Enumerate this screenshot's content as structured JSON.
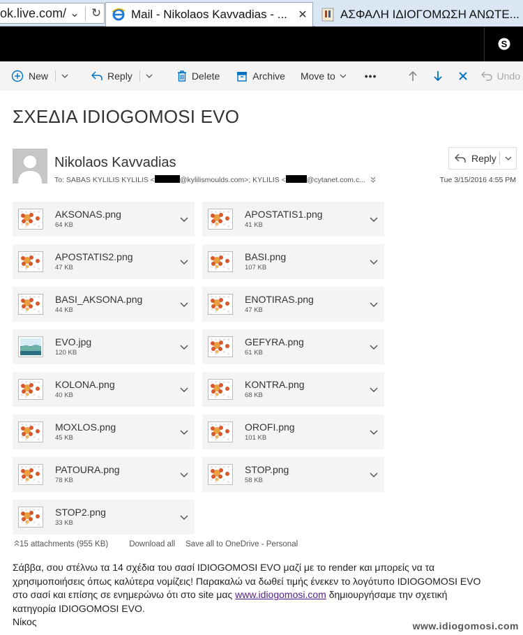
{
  "browser": {
    "address_fragment": "ok.live.com/",
    "tabs": [
      {
        "title": "Mail - Nikolaos Kavvadias - ...",
        "active": true
      },
      {
        "title": "ΑΣΦΑΛΗ ΙΔΙΟΓΟΜΩΣΗ ΑΝΩΤΕ...",
        "active": false
      }
    ]
  },
  "toolbar": {
    "new_label": "New",
    "reply_label": "Reply",
    "delete_label": "Delete",
    "archive_label": "Archive",
    "move_label": "Move to",
    "more_label": "•••",
    "undo_label": "Undo"
  },
  "message": {
    "subject": "ΣΧΕΔΙΑ IDIOGOMOSI EVO",
    "sender": "Nikolaos Kavvadias",
    "to_prefix": "To: SABAS KYLILIS KYLILIS <",
    "to_mid": "@kylilismoulds.com>; KYLILIS <",
    "to_end": "@cytanet.com.c...",
    "date": "Tue 3/15/2016 4:55 PM",
    "reply_button": "Reply"
  },
  "attachments": [
    {
      "name": "AKSONAS.png",
      "size": "64 KB",
      "kind": "png"
    },
    {
      "name": "APOSTATIS1.png",
      "size": "41 KB",
      "kind": "png"
    },
    {
      "name": "APOSTATIS2.png",
      "size": "47 KB",
      "kind": "png"
    },
    {
      "name": "BASI.png",
      "size": "107 KB",
      "kind": "png"
    },
    {
      "name": "BASI_AKSONA.png",
      "size": "44 KB",
      "kind": "png"
    },
    {
      "name": "ENOTIRAS.png",
      "size": "47 KB",
      "kind": "png"
    },
    {
      "name": "EVO.jpg",
      "size": "120 KB",
      "kind": "jpg"
    },
    {
      "name": "GEFYRA.png",
      "size": "61 KB",
      "kind": "png"
    },
    {
      "name": "KOLONA.png",
      "size": "40 KB",
      "kind": "png"
    },
    {
      "name": "KONTRA.png",
      "size": "68 KB",
      "kind": "png"
    },
    {
      "name": "MOXLOS.png",
      "size": "45 KB",
      "kind": "png"
    },
    {
      "name": "OROFI.png",
      "size": "101 KB",
      "kind": "png"
    },
    {
      "name": "PATOURA.png",
      "size": "78 KB",
      "kind": "png"
    },
    {
      "name": "STOP.png",
      "size": "58 KB",
      "kind": "png"
    },
    {
      "name": "STOP2.png",
      "size": "33 KB",
      "kind": "png"
    }
  ],
  "attachments_footer": {
    "count": "15 attachments (955 KB)",
    "download_all": "Download all",
    "save_onedrive": "Save all to OneDrive - Personal"
  },
  "body": {
    "line1": "Σάββα, σου στέλνω τα 14 σχέδια του σασί IDIOGOMOSI EVO μαζί με το render και μπορείς να τα",
    "line2": "χρησιμοποιήσεις όπως καλύτερα νομίζεις! Παρακαλώ να δωθεί τιμής ένεκεν το λογότυπο IDIOGOMOSI EVO",
    "line3": "στο σασί και επίσης σε ενημερώνω ότι στο site μας",
    "link": "www.idiogomosi.com",
    "line3b": "δημιουργήσαμε την σχετική",
    "line4": "κατηγορία IDIOGOMOSI EVO.",
    "signature": "Νίκος"
  },
  "watermark": "www.idiogomosi.com",
  "colors": {
    "accent": "#0072c6",
    "toolbar_bg": "#f4f4f4",
    "tile_bg": "#f4f4f4"
  }
}
